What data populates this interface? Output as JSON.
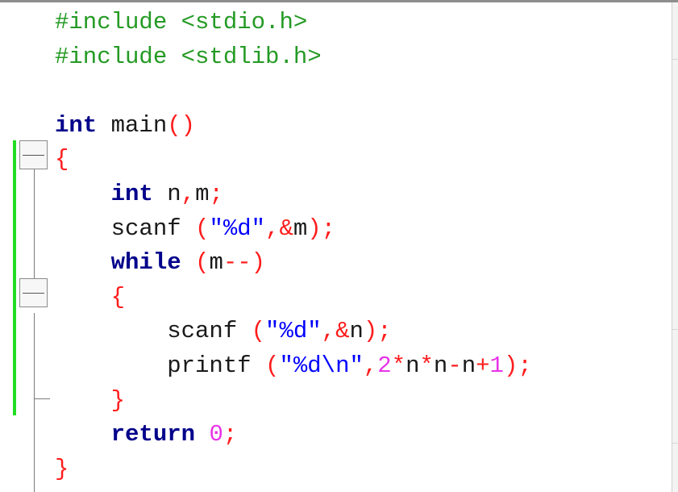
{
  "editor": {
    "lines": [
      [
        {
          "t": "#include <stdio.h>",
          "c": "pre"
        }
      ],
      [
        {
          "t": "#include <stdlib.h>",
          "c": "pre"
        }
      ],
      [],
      [
        {
          "t": "int",
          "c": "kw"
        },
        {
          "t": " main",
          "c": "id"
        },
        {
          "t": "()",
          "c": "sym"
        }
      ],
      [
        {
          "t": "{",
          "c": "sym"
        }
      ],
      [
        {
          "t": "    ",
          "c": "id"
        },
        {
          "t": "int",
          "c": "kw"
        },
        {
          "t": " n",
          "c": "id"
        },
        {
          "t": ",",
          "c": "sym"
        },
        {
          "t": "m",
          "c": "id"
        },
        {
          "t": ";",
          "c": "sym"
        }
      ],
      [
        {
          "t": "    scanf ",
          "c": "id"
        },
        {
          "t": "(",
          "c": "sym"
        },
        {
          "t": "\"%d\"",
          "c": "str"
        },
        {
          "t": ",&",
          "c": "sym"
        },
        {
          "t": "m",
          "c": "id"
        },
        {
          "t": ");",
          "c": "sym"
        }
      ],
      [
        {
          "t": "    ",
          "c": "id"
        },
        {
          "t": "while",
          "c": "kw"
        },
        {
          "t": " ",
          "c": "id"
        },
        {
          "t": "(",
          "c": "sym"
        },
        {
          "t": "m",
          "c": "id"
        },
        {
          "t": "--)",
          "c": "sym"
        }
      ],
      [
        {
          "t": "    ",
          "c": "id"
        },
        {
          "t": "{",
          "c": "sym"
        }
      ],
      [
        {
          "t": "        scanf ",
          "c": "id"
        },
        {
          "t": "(",
          "c": "sym"
        },
        {
          "t": "\"%d\"",
          "c": "str"
        },
        {
          "t": ",&",
          "c": "sym"
        },
        {
          "t": "n",
          "c": "id"
        },
        {
          "t": ");",
          "c": "sym"
        }
      ],
      [
        {
          "t": "        printf ",
          "c": "id"
        },
        {
          "t": "(",
          "c": "sym"
        },
        {
          "t": "\"%d\\n\"",
          "c": "str"
        },
        {
          "t": ",",
          "c": "sym"
        },
        {
          "t": "2",
          "c": "num"
        },
        {
          "t": "*",
          "c": "sym"
        },
        {
          "t": "n",
          "c": "id"
        },
        {
          "t": "*",
          "c": "sym"
        },
        {
          "t": "n",
          "c": "id"
        },
        {
          "t": "-",
          "c": "sym"
        },
        {
          "t": "n",
          "c": "id"
        },
        {
          "t": "+",
          "c": "sym"
        },
        {
          "t": "1",
          "c": "num"
        },
        {
          "t": ");",
          "c": "sym"
        }
      ],
      [
        {
          "t": "    ",
          "c": "id"
        },
        {
          "t": "}",
          "c": "sym"
        }
      ],
      [
        {
          "t": "    ",
          "c": "id"
        },
        {
          "t": "return",
          "c": "kw"
        },
        {
          "t": " ",
          "c": "id"
        },
        {
          "t": "0",
          "c": "num"
        },
        {
          "t": ";",
          "c": "sym"
        }
      ],
      [
        {
          "t": "}",
          "c": "sym"
        }
      ]
    ]
  },
  "gutter": {
    "fold_markers": [
      {
        "name": "fold-toggle-main-icon",
        "state": "expanded"
      },
      {
        "name": "fold-toggle-while-icon",
        "state": "expanded"
      }
    ]
  },
  "colors": {
    "keyword": "#00008b",
    "preprocessor": "#249a24",
    "symbol": "#ff1c1c",
    "number": "#e733e7",
    "string": "#0000ff",
    "identifier": "#1a1a1a",
    "changed_lines_bar": "#22dd22"
  }
}
